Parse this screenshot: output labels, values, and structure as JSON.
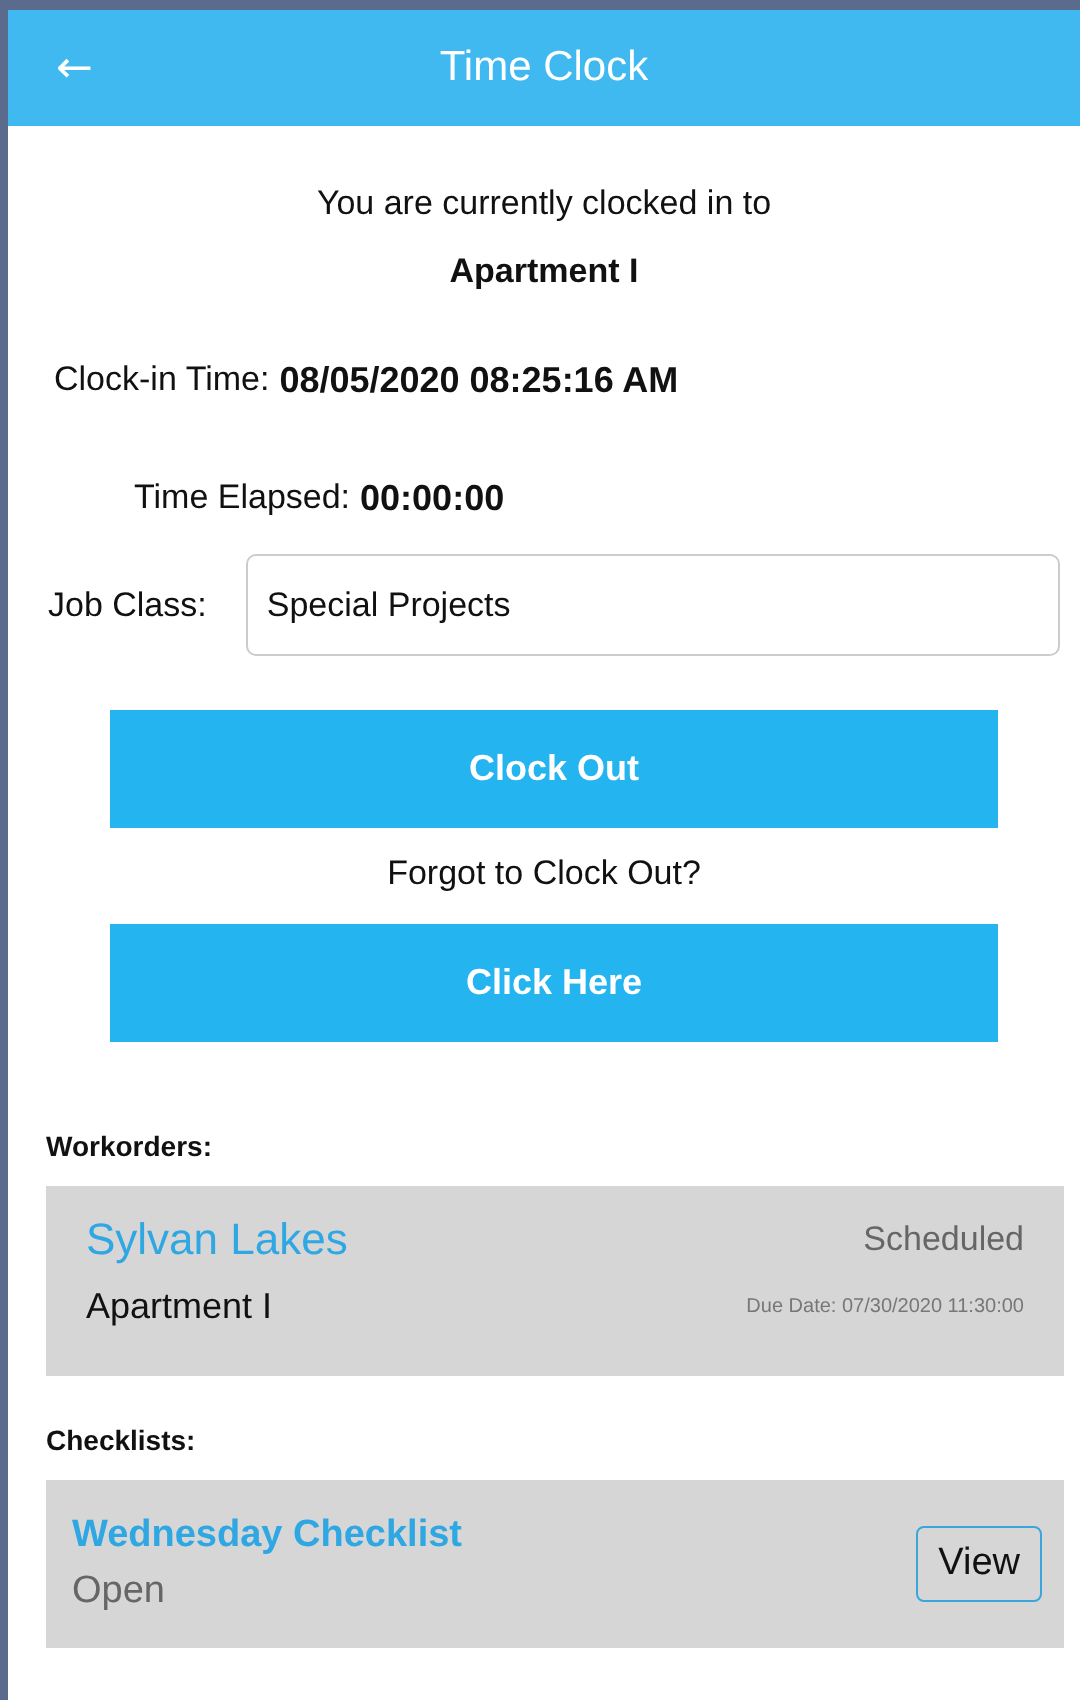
{
  "header": {
    "back_icon": "←",
    "title": "Time Clock"
  },
  "status": {
    "intro": "You are currently clocked in to",
    "location": "Apartment I"
  },
  "clock_in": {
    "label": "Clock-in Time:",
    "value": "08/05/2020 08:25:16 AM"
  },
  "elapsed": {
    "label": "Time Elapsed:",
    "value": "00:00:00"
  },
  "job_class": {
    "label": "Job Class:",
    "value": "Special Projects"
  },
  "clock_out_button": "Clock Out",
  "forgot_prompt": "Forgot to Clock Out?",
  "click_here_button": "Click Here",
  "workorders": {
    "heading": "Workorders:",
    "items": [
      {
        "title": "Sylvan Lakes",
        "status": "Scheduled",
        "unit": "Apartment I",
        "due": "Due Date: 07/30/2020 11:30:00"
      }
    ]
  },
  "checklists": {
    "heading": "Checklists:",
    "items": [
      {
        "title": "Wednesday Checklist",
        "status": "Open",
        "action": "View"
      }
    ]
  }
}
